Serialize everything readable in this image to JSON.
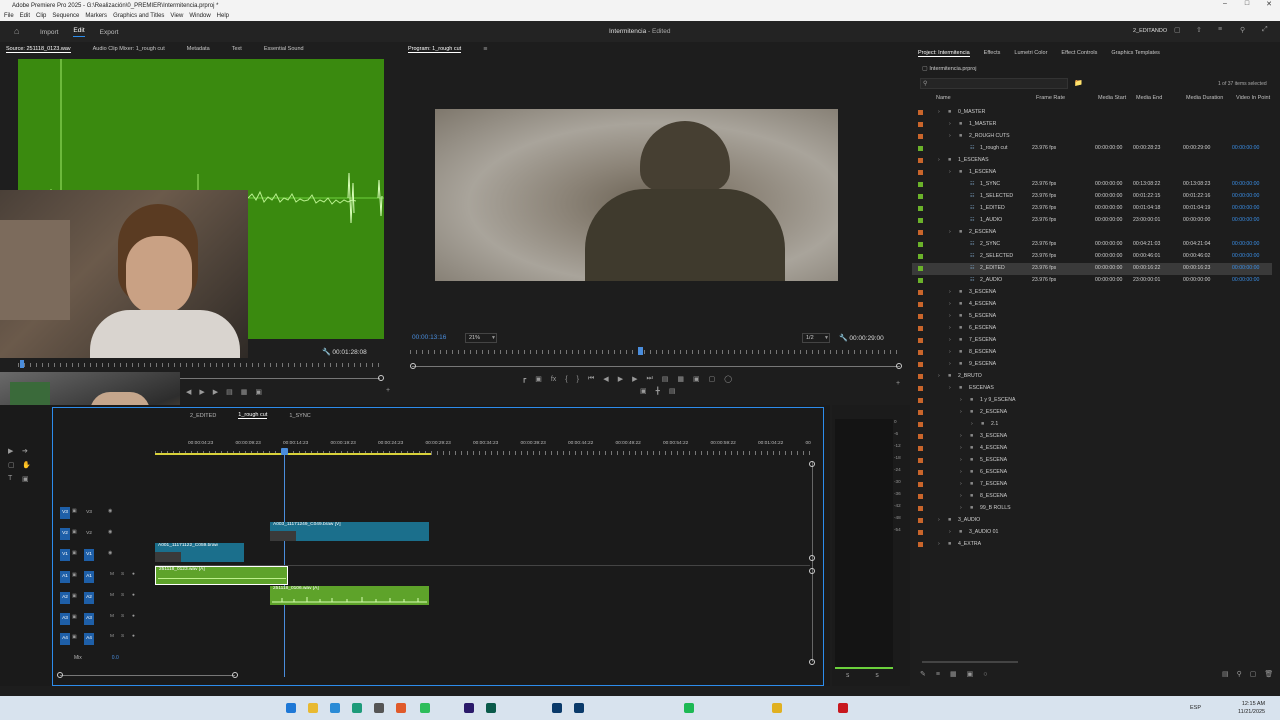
{
  "window": {
    "title": "Adobe Premiere Pro 2025 - G:\\Realización\\0_PREMIER\\Intermitencia.prproj *"
  },
  "menu": [
    "File",
    "Edit",
    "Clip",
    "Sequence",
    "Markers",
    "Graphics and Titles",
    "View",
    "Window",
    "Help"
  ],
  "workspace": {
    "tabs": [
      "Import",
      "Edit",
      "Export"
    ],
    "active_tab": "Edit",
    "project_title": "Intermitencia",
    "edited": "- Edited",
    "workspace_name": "2_EDITANDO"
  },
  "source": {
    "tabs": [
      "Source: 251118_0123.wav",
      "Audio Clip Mixer: 1_rough cut",
      "Metadata",
      "Text",
      "Essential Sound"
    ],
    "duration": "00:01:28:08"
  },
  "program": {
    "tab": "Program: 1_rough cut",
    "timecode": "00:00:13:16",
    "zoom": "21%",
    "quality": "1/2",
    "duration": "00:00:29:00"
  },
  "project": {
    "tabs": [
      "Project: Intermitencia",
      "Effects",
      "Lumetri Color",
      "Effect Controls",
      "Graphics Templates"
    ],
    "file": "Intermitencia.prproj",
    "count": "1 of 37 items selected",
    "columns": [
      "Name",
      "Frame Rate",
      "Media Start",
      "Media End",
      "Media Duration",
      "Video In Point"
    ],
    "rows": [
      {
        "name": "0_MASTER",
        "indent": 0,
        "type": "bin",
        "fr": "",
        "ms": "",
        "me": "",
        "md": "",
        "vi": ""
      },
      {
        "name": "1_MASTER",
        "indent": 1,
        "type": "bin",
        "fr": "",
        "ms": "",
        "me": "",
        "md": "",
        "vi": ""
      },
      {
        "name": "2_ROUGH CUTS",
        "indent": 1,
        "type": "bin",
        "fr": "",
        "ms": "",
        "me": "",
        "md": "",
        "vi": ""
      },
      {
        "name": "1_rough cut",
        "indent": 2,
        "type": "seq",
        "fr": "23.976 fps",
        "ms": "00:00:00:00",
        "me": "00:00:28:23",
        "md": "00:00:29:00",
        "vi": "00:00:00:00"
      },
      {
        "name": "1_ESCENAS",
        "indent": 0,
        "type": "bin",
        "fr": "",
        "ms": "",
        "me": "",
        "md": "",
        "vi": ""
      },
      {
        "name": "1_ESCENA",
        "indent": 1,
        "type": "bin",
        "fr": "",
        "ms": "",
        "me": "",
        "md": "",
        "vi": ""
      },
      {
        "name": "1_SYNC",
        "indent": 2,
        "type": "seq",
        "fr": "23.976 fps",
        "ms": "00:00:00:00",
        "me": "00:13:08:22",
        "md": "00:13:08:23",
        "vi": "00:00:00:00"
      },
      {
        "name": "1_SELECTED",
        "indent": 2,
        "type": "seq",
        "fr": "23.976 fps",
        "ms": "00:00:00:00",
        "me": "00:01:22:15",
        "md": "00:01:22:16",
        "vi": "00:00:00:00"
      },
      {
        "name": "1_EDITED",
        "indent": 2,
        "type": "seq",
        "fr": "23.976 fps",
        "ms": "00:00:00:00",
        "me": "00:01:04:18",
        "md": "00:01:04:19",
        "vi": "00:00:00:00"
      },
      {
        "name": "1_AUDIO",
        "indent": 2,
        "type": "seq",
        "fr": "23.976 fps",
        "ms": "00:00:00:00",
        "me": "23:00:00:01",
        "md": "00:00:00:00",
        "vi": "00:00:00:00"
      },
      {
        "name": "2_ESCENA",
        "indent": 1,
        "type": "bin",
        "fr": "",
        "ms": "",
        "me": "",
        "md": "",
        "vi": ""
      },
      {
        "name": "2_SYNC",
        "indent": 2,
        "type": "seq",
        "fr": "23.976 fps",
        "ms": "00:00:00:00",
        "me": "00:04:21:03",
        "md": "00:04:21:04",
        "vi": "00:00:00:00"
      },
      {
        "name": "2_SELECTED",
        "indent": 2,
        "type": "seq",
        "fr": "23.976 fps",
        "ms": "00:00:00:00",
        "me": "00:00:46:01",
        "md": "00:00:46:02",
        "vi": "00:00:00:00"
      },
      {
        "name": "2_EDITED",
        "indent": 2,
        "type": "seq",
        "fr": "23.976 fps",
        "ms": "00:00:00:00",
        "me": "00:00:16:22",
        "md": "00:00:16:23",
        "vi": "00:00:00:00",
        "selected": true
      },
      {
        "name": "2_AUDIO",
        "indent": 2,
        "type": "seq",
        "fr": "23.976 fps",
        "ms": "00:00:00:00",
        "me": "23:00:00:01",
        "md": "00:00:00:00",
        "vi": "00:00:00:00"
      },
      {
        "name": "3_ESCENA",
        "indent": 1,
        "type": "bin",
        "fr": "",
        "ms": "",
        "me": "",
        "md": "",
        "vi": ""
      },
      {
        "name": "4_ESCENA",
        "indent": 1,
        "type": "bin",
        "fr": "",
        "ms": "",
        "me": "",
        "md": "",
        "vi": ""
      },
      {
        "name": "5_ESCENA",
        "indent": 1,
        "type": "bin",
        "fr": "",
        "ms": "",
        "me": "",
        "md": "",
        "vi": ""
      },
      {
        "name": "6_ESCENA",
        "indent": 1,
        "type": "bin",
        "fr": "",
        "ms": "",
        "me": "",
        "md": "",
        "vi": ""
      },
      {
        "name": "7_ESCENA",
        "indent": 1,
        "type": "bin",
        "fr": "",
        "ms": "",
        "me": "",
        "md": "",
        "vi": ""
      },
      {
        "name": "8_ESCENA",
        "indent": 1,
        "type": "bin",
        "fr": "",
        "ms": "",
        "me": "",
        "md": "",
        "vi": ""
      },
      {
        "name": "9_ESCENA",
        "indent": 1,
        "type": "bin",
        "fr": "",
        "ms": "",
        "me": "",
        "md": "",
        "vi": ""
      },
      {
        "name": "2_BRUTO",
        "indent": 0,
        "type": "bin",
        "fr": "",
        "ms": "",
        "me": "",
        "md": "",
        "vi": ""
      },
      {
        "name": "ESCENAS",
        "indent": 1,
        "type": "bin",
        "fr": "",
        "ms": "",
        "me": "",
        "md": "",
        "vi": ""
      },
      {
        "name": "1 y 9_ESCENA",
        "indent": 2,
        "type": "bin",
        "fr": "",
        "ms": "",
        "me": "",
        "md": "",
        "vi": ""
      },
      {
        "name": "2_ESCENA",
        "indent": 2,
        "type": "bin",
        "fr": "",
        "ms": "",
        "me": "",
        "md": "",
        "vi": ""
      },
      {
        "name": "2.1",
        "indent": 3,
        "type": "bin",
        "fr": "",
        "ms": "",
        "me": "",
        "md": "",
        "vi": ""
      },
      {
        "name": "3_ESCENA",
        "indent": 2,
        "type": "bin",
        "fr": "",
        "ms": "",
        "me": "",
        "md": "",
        "vi": ""
      },
      {
        "name": "4_ESCENA",
        "indent": 2,
        "type": "bin",
        "fr": "",
        "ms": "",
        "me": "",
        "md": "",
        "vi": ""
      },
      {
        "name": "5_ESCENA",
        "indent": 2,
        "type": "bin",
        "fr": "",
        "ms": "",
        "me": "",
        "md": "",
        "vi": ""
      },
      {
        "name": "6_ESCENA",
        "indent": 2,
        "type": "bin",
        "fr": "",
        "ms": "",
        "me": "",
        "md": "",
        "vi": ""
      },
      {
        "name": "7_ESCENA",
        "indent": 2,
        "type": "bin",
        "fr": "",
        "ms": "",
        "me": "",
        "md": "",
        "vi": ""
      },
      {
        "name": "8_ESCENA",
        "indent": 2,
        "type": "bin",
        "fr": "",
        "ms": "",
        "me": "",
        "md": "",
        "vi": ""
      },
      {
        "name": "99_B ROLLS",
        "indent": 2,
        "type": "bin",
        "fr": "",
        "ms": "",
        "me": "",
        "md": "",
        "vi": ""
      },
      {
        "name": "3_AUDIO",
        "indent": 0,
        "type": "bin",
        "fr": "",
        "ms": "",
        "me": "",
        "md": "",
        "vi": ""
      },
      {
        "name": "3_AUDIO 01",
        "indent": 1,
        "type": "bin",
        "fr": "",
        "ms": "",
        "me": "",
        "md": "",
        "vi": ""
      },
      {
        "name": "4_EXTRA",
        "indent": 0,
        "type": "bin",
        "fr": "",
        "ms": "",
        "me": "",
        "md": "",
        "vi": ""
      }
    ]
  },
  "timeline": {
    "tabs": [
      "2_EDITED",
      "1_rough cut",
      "1_SYNC"
    ],
    "active_tab": "1_rough cut",
    "ruler": [
      "00:00:04:23",
      "00:00:09:23",
      "00:00:14:23",
      "00:00:19:23",
      "00:00:24:23",
      "00:00:29:23",
      "00:00:34:23",
      "00:00:39:23",
      "00:00:44:22",
      "00:00:49:22",
      "00:00:54:22",
      "00:00:59:22",
      "00:01:04:22",
      "00"
    ],
    "tracks": [
      "V3",
      "V2",
      "V1",
      "A1",
      "A2",
      "A3",
      "A4"
    ],
    "mix_label": "Mix",
    "mix_value": "0.0",
    "clips": {
      "v2": "A003_11171249_C049.braw [V]",
      "v1": "A001_11171122_C059.braw",
      "a1": "251118_0123.wav [A]",
      "a2": "251118_0106.wav [A]"
    }
  },
  "meter_scale": [
    "0",
    "-6",
    "-12",
    "-18",
    "-24",
    "-30",
    "-36",
    "-42",
    "-48",
    "-54"
  ],
  "meter_bottom": [
    "S",
    "S"
  ],
  "taskbar": {
    "lang": "ESP",
    "time": "12:15 AM",
    "date": "11/21/2025"
  },
  "colors": {
    "accent": "#2d8ceb",
    "timecode": "#4a8ddc",
    "audio_clip": "#5ea32a",
    "video_clip": "#1b6f8c",
    "green_screen": "#3a8a0f"
  }
}
